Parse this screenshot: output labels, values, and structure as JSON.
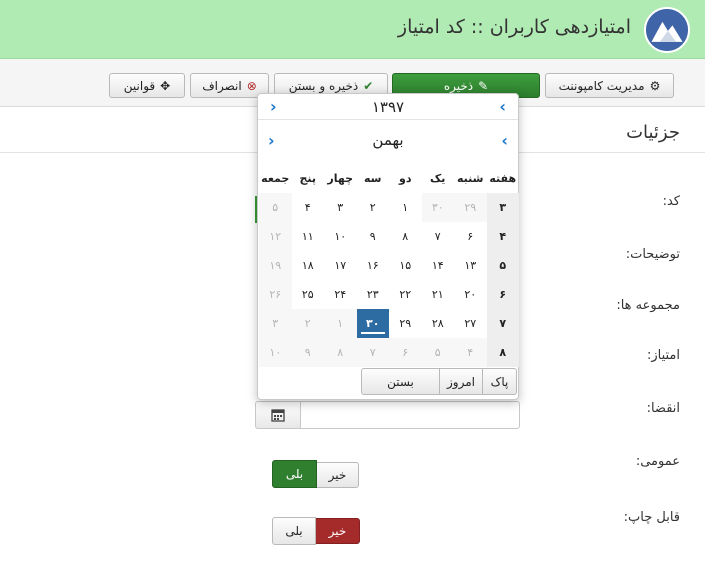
{
  "header": {
    "title": "امتیازدهی کاربران :: کد امتیاز"
  },
  "toolbar": {
    "component_mgmt": {
      "label": "مدیریت کامپوننت",
      "icon": "gear-icon"
    },
    "save": {
      "label": "ذخیره",
      "icon": "edit-icon"
    },
    "save_close": {
      "label": "ذخیره و بستن",
      "icon": "check-icon"
    },
    "cancel": {
      "label": "انصراف",
      "icon": "cancel-circle-icon"
    },
    "rules": {
      "label": "قوانین",
      "icon": "move-icon"
    }
  },
  "details": {
    "title": "جزئیات",
    "fields": {
      "code": "کد:",
      "description": "توضیحات:",
      "groups": "مجموعه ها:",
      "points": "امتیاز:",
      "expiry": "انقضا:",
      "public": "عمومی:",
      "printable": "قابل چاپ:"
    },
    "public_toggle": {
      "no": "خیر",
      "yes": "بلی",
      "selected": "yes"
    },
    "printable_toggle": {
      "no": "خیر",
      "yes": "بلی",
      "selected": "no"
    }
  },
  "calendar": {
    "year": "۱۳۹۷",
    "month": "بهمن",
    "headers": [
      "هفته",
      "شنبه",
      "یک",
      "دو",
      "سه",
      "چهار",
      "پنج",
      "جمعه"
    ],
    "weeks": [
      {
        "wk": "۳",
        "days": [
          "۲۹",
          "۳۰",
          "۱",
          "۲",
          "۳",
          "۴",
          "۵"
        ],
        "other": [
          true,
          true,
          false,
          false,
          false,
          false,
          true
        ]
      },
      {
        "wk": "۴",
        "days": [
          "۶",
          "۷",
          "۸",
          "۹",
          "۱۰",
          "۱۱",
          "۱۲"
        ],
        "other": [
          false,
          false,
          false,
          false,
          false,
          false,
          true
        ]
      },
      {
        "wk": "۵",
        "days": [
          "۱۳",
          "۱۴",
          "۱۵",
          "۱۶",
          "۱۷",
          "۱۸",
          "۱۹"
        ],
        "other": [
          false,
          false,
          false,
          false,
          false,
          false,
          true
        ]
      },
      {
        "wk": "۶",
        "days": [
          "۲۰",
          "۲۱",
          "۲۲",
          "۲۳",
          "۲۴",
          "۲۵",
          "۲۶"
        ],
        "other": [
          false,
          false,
          false,
          false,
          false,
          false,
          true
        ]
      },
      {
        "wk": "۷",
        "days": [
          "۲۷",
          "۲۸",
          "۲۹",
          "۳۰",
          "۱",
          "۲",
          "۳"
        ],
        "other": [
          false,
          false,
          false,
          false,
          true,
          true,
          true
        ]
      },
      {
        "wk": "۸",
        "days": [
          "۴",
          "۵",
          "۶",
          "۷",
          "۸",
          "۹",
          "۱۰"
        ],
        "other": [
          true,
          true,
          true,
          true,
          true,
          true,
          true
        ]
      }
    ],
    "selected": {
      "week": 4,
      "day": 3
    },
    "footer": {
      "clear": "پاک",
      "today": "امروز",
      "close": "بستن"
    }
  }
}
